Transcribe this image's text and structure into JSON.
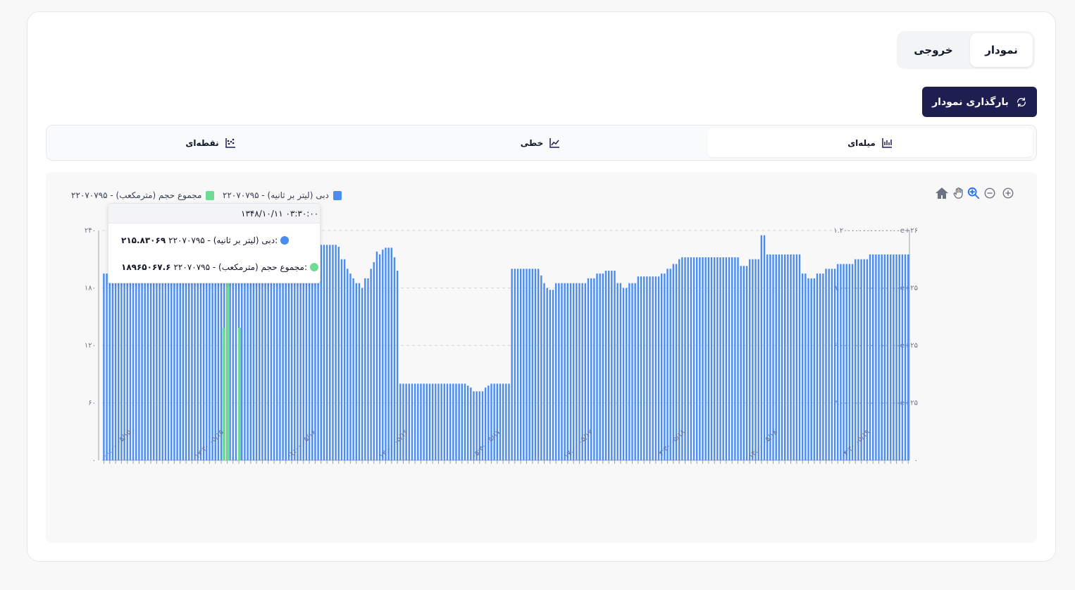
{
  "tabs": [
    {
      "label": "نمودار",
      "active": true
    },
    {
      "label": "خروجی",
      "active": false
    }
  ],
  "reload_label": "بارگذاری نمودار",
  "chart_types": [
    {
      "label": "میله‌ای",
      "icon": "bar-chart-icon",
      "active": true
    },
    {
      "label": "خطی",
      "icon": "line-chart-icon",
      "active": false
    },
    {
      "label": "نقطه‌ای",
      "icon": "scatter-chart-icon",
      "active": false
    }
  ],
  "toolbar": [
    "home-icon",
    "pan-icon",
    "zoom-icon",
    "zoom-out-icon",
    "zoom-in-icon"
  ],
  "tooltip": {
    "title": "۱۳۴۸/۱۰/۱۱ ۰۳:۳۰:۰۰",
    "rows": [
      {
        "label": "۲۲۰۷۰۷۹۵ - دبی (لیتر بر ثانیه):",
        "value": "۲۱۵.۸۳۰۶۹",
        "color": "#4a8cf1"
      },
      {
        "label": "۲۲۰۷۰۷۹۵ - مجموع حجم (مترمکعب):",
        "value": "۱۸۹۶۵۰۶۷.۶",
        "color": "#6fdc96"
      }
    ]
  },
  "chart_data": {
    "type": "bar",
    "legend_position": "top-left",
    "grid": true,
    "series": [
      {
        "name": "۲۲۰۷۰۷۹۵ - دبی (لیتر بر ثانیه)",
        "color": "#4a8cf1",
        "axis": "left",
        "values": [
          195,
          195,
          195,
          195,
          195,
          195,
          195,
          195,
          195,
          195,
          195,
          195,
          195,
          195,
          195,
          195,
          195,
          195,
          195,
          195,
          195,
          195,
          195,
          195,
          195,
          195,
          195,
          195,
          195,
          195,
          195,
          195,
          195,
          195,
          195,
          195,
          195,
          195,
          195,
          195,
          195,
          195,
          195,
          195,
          195,
          195,
          195,
          195,
          210,
          210,
          210,
          210,
          210,
          210,
          210,
          210,
          210,
          210,
          210,
          210,
          210,
          210,
          210,
          210,
          210,
          210,
          210,
          210,
          210,
          210,
          218,
          222,
          225,
          225,
          225,
          225,
          225,
          225,
          225,
          225,
          223,
          210,
          210,
          200,
          195,
          190,
          185,
          185,
          180,
          190,
          190,
          200,
          207,
          218,
          215,
          220,
          222,
          222,
          222,
          212,
          198,
          80,
          80,
          80,
          80,
          80,
          80,
          80,
          80,
          80,
          80,
          80,
          80,
          80,
          80,
          80,
          80,
          80,
          80,
          80,
          80,
          80,
          80,
          80,
          78,
          76,
          72,
          72,
          72,
          72,
          76,
          78,
          80,
          80,
          80,
          80,
          80,
          80,
          80,
          200,
          200,
          200,
          200,
          200,
          200,
          200,
          200,
          200,
          200,
          193,
          185,
          180,
          178,
          178,
          185,
          185,
          185,
          185,
          185,
          185,
          185,
          185,
          185,
          185,
          185,
          190,
          190,
          190,
          195,
          195,
          195,
          198,
          198,
          198,
          198,
          185,
          185,
          180,
          180,
          185,
          185,
          185,
          192,
          192,
          192,
          192,
          192,
          192,
          192,
          192,
          195,
          195,
          200,
          200,
          205,
          205,
          210,
          212,
          212,
          212,
          212,
          212,
          212,
          212,
          212,
          212,
          212,
          212,
          212,
          212,
          212,
          212,
          212,
          212,
          212,
          212,
          212,
          203,
          203,
          203,
          210,
          210,
          210,
          210,
          235,
          235,
          215,
          215,
          215,
          215,
          215,
          215,
          215,
          215,
          215,
          215,
          215,
          215,
          195,
          195,
          190,
          190,
          190,
          195,
          195,
          195,
          200,
          200,
          200,
          200,
          205,
          205,
          205,
          205,
          205,
          205,
          210,
          210,
          210,
          210,
          210,
          215,
          215,
          215,
          215,
          215,
          215,
          215,
          215,
          215,
          215,
          215,
          215,
          215,
          215
        ]
      },
      {
        "name": "۲۲۰۷۰۷۹۵ - مجموع حجم (مترمکعب)",
        "color": "#6fdc96",
        "axis": "right",
        "points": [
          {
            "x": "۱۲:۳۰:۰۰",
            "y": 18965067.6
          },
          {
            "x": "۱۳:۰۰:۰۰",
            "y": 18965067.6
          },
          {
            "x": "۱۳:۳۰:۰۰",
            "y": 18965067.6
          }
        ]
      }
    ],
    "x_tick_labels": [
      "۰۰:۰۰ ۰۵/۱۵",
      "۱۲:۳۰ ۰۵/۱۵",
      "۰۲:۰۰ ۰۵/۱۶",
      "۱۲:۰۰ ۰۵/۱۶",
      "۰۵:۳۰ ۰۵/۱۷",
      "۱۷:۰۰ ۰۵/۱۷",
      "۰۴:۳۰ ۰۵/۱۸",
      "۱۴:۰۰ ۰۵/۱۸",
      "۰۴:۳۰ ۰۵/۱۹"
    ],
    "y_left": {
      "ticks": [
        "۰",
        "۶۰",
        "۱۲۰",
        "۱۸۰",
        "۲۴۰"
      ],
      "range": [
        0,
        240
      ]
    },
    "y_right": {
      "ticks": [
        "۰",
        "۳.۰۰۰۰۰۰۰۰۰۰۰۰۰۰۰۰e+۲۵",
        "۶.۰۰۰۰۰۰۰۰۰۰۰۰۰۰۰۰e+۲۵",
        "۹.۰۰۰۰۰۰۰۰۰۰۰۰۰۰۰۰e+۲۵",
        "۱.۲۰۰۰۰۰۰۰۰۰۰۰۰۰۰۰e+۲۶"
      ],
      "range": [
        0,
        1.2e+26
      ]
    }
  }
}
